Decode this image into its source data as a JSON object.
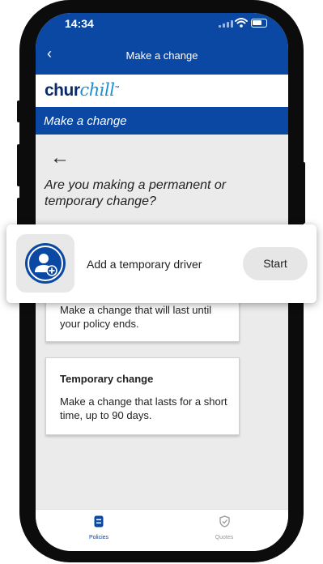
{
  "status_bar": {
    "time": "14:34"
  },
  "nav": {
    "title": "Make a change"
  },
  "brand": {
    "logo_part1": "chur",
    "logo_part2": "chill",
    "logo_tm": "™"
  },
  "page": {
    "header": "Make a change",
    "question": "Are you making a permanent or temporary change?",
    "cards": [
      {
        "title": "",
        "body": "Make a change that will last until your policy ends."
      },
      {
        "title": "Temporary change",
        "body": "Make a change that lasts for a short time, up to 90 days."
      }
    ]
  },
  "tabs": [
    {
      "label": "Policies",
      "icon": "policy-document-icon",
      "active": true
    },
    {
      "label": "Quotes",
      "icon": "shield-check-icon",
      "active": false
    }
  ],
  "overlay": {
    "text": "Add a temporary driver",
    "button_label": "Start",
    "icon": "add-user-icon"
  },
  "colors": {
    "brand_blue": "#0a48a4",
    "logo_navy": "#0a2a6e",
    "logo_light": "#1a8fd6",
    "background": "#ebebeb"
  }
}
